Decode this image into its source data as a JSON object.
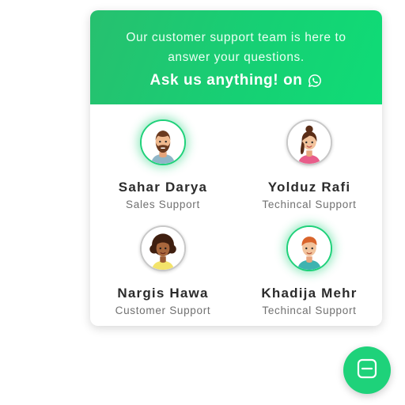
{
  "header": {
    "intro_line_1": "Our customer support team is here to",
    "intro_line_2": "answer your questions.",
    "cta_text": "Ask us anything! on",
    "cta_icon": "whatsapp-icon"
  },
  "agents": [
    {
      "name": "Sahar Darya",
      "role": "Sales Support",
      "status": "online",
      "avatar": "bearded-man-avatar"
    },
    {
      "name": "Yolduz Rafi",
      "role": "Techincal Support",
      "status": "offline",
      "avatar": "woman-bun-avatar"
    },
    {
      "name": "Nargis Hawa",
      "role": "Customer Support",
      "status": "offline",
      "avatar": "curly-hair-woman-avatar"
    },
    {
      "name": "Khadija Mehr",
      "role": "Techincal Support",
      "status": "online",
      "avatar": "young-man-avatar"
    }
  ],
  "fab": {
    "icon": "chat-toggle-icon"
  },
  "colors": {
    "accent": "#1ed27a",
    "header_start": "#27c06f",
    "header_end": "#0fdc76",
    "name_text": "#2b2b2b",
    "role_text": "#707070"
  }
}
